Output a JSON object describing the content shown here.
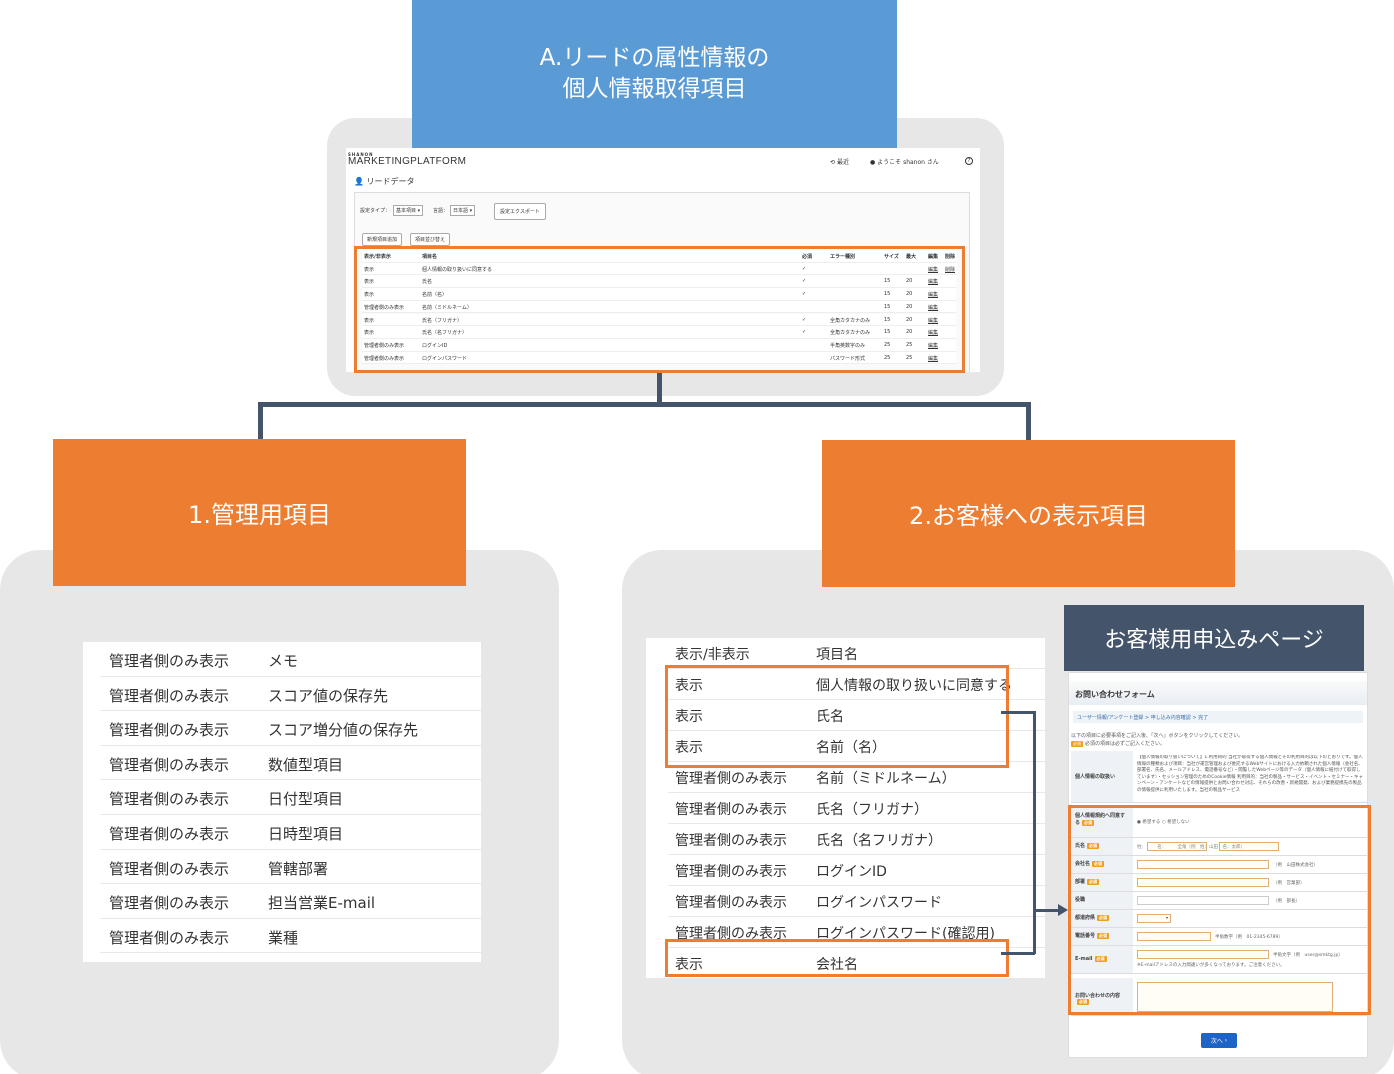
{
  "top_box": {
    "line1": "A.リードの属性情報の",
    "line2": "個人情報取得項目"
  },
  "left_box": {
    "label": "1.管理用項目"
  },
  "right_box": {
    "label": "2.お客様への表示項目"
  },
  "customer_page_label": "お客様用申込みページ",
  "admin_screenshot": {
    "brand_small": "SHANON",
    "brand": "MARKETINGPLATFORM",
    "header_links": [
      "最近",
      "ようこそ shanon さん",
      "?"
    ],
    "section_title": "リードデータ",
    "setting_type_label": "設定タイプ：",
    "setting_type_value": "基本項目",
    "language_label": "言語：",
    "language_value": "日本語",
    "export_button": "設定エクスポート",
    "add_button": "新規項目追加",
    "reorder_button": "項目並び替え",
    "columns": [
      "表示/非表示",
      "項目名",
      "必須",
      "エラー種別",
      "サイズ",
      "最大",
      "編集",
      "削除"
    ],
    "rows": [
      [
        "表示",
        "個人情報の取り扱いに同意する",
        "✓",
        "",
        "",
        "",
        "編集",
        "削除"
      ],
      [
        "表示",
        "氏名",
        "✓",
        "",
        "15",
        "20",
        "編集",
        ""
      ],
      [
        "表示",
        "名前（名）",
        "✓",
        "",
        "15",
        "20",
        "編集",
        ""
      ],
      [
        "管理者側のみ表示",
        "名前（ミドルネーム）",
        "",
        "",
        "15",
        "20",
        "編集",
        ""
      ],
      [
        "表示",
        "氏名（フリガナ）",
        "✓",
        "全角カタカナのみ",
        "15",
        "20",
        "編集",
        ""
      ],
      [
        "表示",
        "氏名（名フリガナ）",
        "✓",
        "全角カタカナのみ",
        "15",
        "20",
        "編集",
        ""
      ],
      [
        "管理者側のみ表示",
        "ログインID",
        "",
        "半角英数字のみ",
        "25",
        "25",
        "編集",
        ""
      ],
      [
        "管理者側のみ表示",
        "ログインパスワード",
        "",
        "パスワード形式",
        "25",
        "25",
        "編集",
        ""
      ]
    ]
  },
  "left_table": {
    "rows": [
      [
        "管理者側のみ表示",
        "メモ"
      ],
      [
        "管理者側のみ表示",
        "スコア値の保存先"
      ],
      [
        "管理者側のみ表示",
        "スコア増分値の保存先"
      ],
      [
        "管理者側のみ表示",
        "数値型項目"
      ],
      [
        "管理者側のみ表示",
        "日付型項目"
      ],
      [
        "管理者側のみ表示",
        "日時型項目"
      ],
      [
        "管理者側のみ表示",
        "管轄部署"
      ],
      [
        "管理者側のみ表示",
        "担当営業E-mail"
      ],
      [
        "管理者側のみ表示",
        "業種"
      ]
    ]
  },
  "right_table": {
    "header": [
      "表示/非表示",
      "項目名"
    ],
    "rows": [
      [
        "表示",
        "個人情報の取り扱いに同意する"
      ],
      [
        "表示",
        "氏名"
      ],
      [
        "表示",
        "名前（名）"
      ],
      [
        "管理者側のみ表示",
        "名前（ミドルネーム）"
      ],
      [
        "管理者側のみ表示",
        "氏名（フリガナ）"
      ],
      [
        "管理者側のみ表示",
        "氏名（名フリガナ）"
      ],
      [
        "管理者側のみ表示",
        "ログインID"
      ],
      [
        "管理者側のみ表示",
        "ログインパスワード"
      ],
      [
        "管理者側のみ表示",
        "ログインパスワード(確認用)"
      ],
      [
        "表示",
        "会社名"
      ]
    ]
  },
  "form_screenshot": {
    "title": "お問い合わせフォーム",
    "steps": "ユーザー情報/アンケート登録 > 申し込み内容確認 > 完了",
    "intro1": "以下の項目に必要事項をご記入後、「次へ」ボタンをクリックしてください。",
    "intro2": "必須の項目は必ずご記入ください。",
    "required_badge": "必須",
    "privacy_label": "個人情報の取扱い",
    "privacy_text": "【個人情報の取り扱いについて】1.利用目的 当社が取得する個人情報とその利用目的は以下のとおりです。個人情報の種類および項目：当社が運営管理および委託するWebサイトにおける入力依頼された個人情報（会社名、部署名、氏名、メールアドレス、電話番号など）・閲覧したWebページ等のデータ（個人情報に紐付けて取得しています）・セッション管理のためのCookie情報 利用目的：当社の製品・サービス・イベント・セミナー・キャンペーン・アンケートなどの情報提供とお問い合わせ対応、それらの改善・新規開発、および業務提携先の製品の情報提供に利用いたします。当社の製品サービス",
    "fields": [
      {
        "label": "個人情報規約へ同意する",
        "hint": "● 希望する ○ 希望しない"
      },
      {
        "label": "氏名",
        "hint": "姓：　　　名：　　　全角（例　姓：山田　名：太郎）"
      },
      {
        "label": "会社名",
        "hint": "（例　山田株式会社）"
      },
      {
        "label": "部署",
        "hint": "（例　営業部）"
      },
      {
        "label": "役職",
        "hint": "（例　部長）"
      },
      {
        "label": "都道府県",
        "hint": ""
      },
      {
        "label": "電話番号",
        "hint": "半角数字（例　01-2345-6789）"
      },
      {
        "label": "E-mail",
        "hint": "半角文字（例　user@smktg.jp）",
        "hint2": "※E-mailアドレスの入力間違いが多くなっております。ご注意ください。"
      },
      {
        "label": "お問い合わせの内容",
        "hint": ""
      }
    ],
    "next_button": "次へ"
  }
}
